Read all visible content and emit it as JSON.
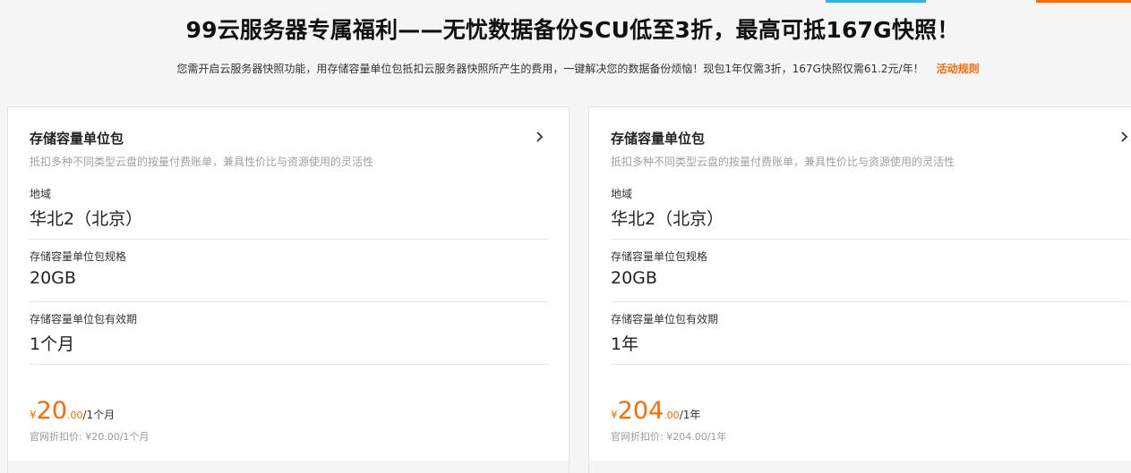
{
  "header": {
    "title": "99云服务器专属福利——无忧数据备份SCU低至3折，最高可抵167G快照！",
    "subtitle": "您需开启云服务器快照功能，用存储容量单位包抵扣云服务器快照所产生的费用，一键解决您的数据备份烦恼！现包1年仅需3折，167G快照仅需61.2元/年！",
    "rules_link": "活动规则"
  },
  "colors": {
    "accent": "#ff6a00",
    "top_blue": "#2fb0e8"
  },
  "cards": [
    {
      "title": "存储容量单位包",
      "arrow_icon": "chevron-right-icon",
      "description": "抵扣多种不同类型云盘的按量付费账单，兼具性价比与资源使用的灵活性",
      "region_label": "地域",
      "region_value": "华北2（北京）",
      "spec_label": "存储容量单位包规格",
      "spec_value": "20GB",
      "period_label": "存储容量单位包有效期",
      "period_value": "1个月",
      "currency": "¥",
      "price_int": "20",
      "price_dec": ".00",
      "price_unit": "/1个月",
      "list_price": "官网折扣价: ¥20.00/1个月"
    },
    {
      "title": "存储容量单位包",
      "arrow_icon": "chevron-right-icon",
      "description": "抵扣多种不同类型云盘的按量付费账单，兼具性价比与资源使用的灵活性",
      "region_label": "地域",
      "region_value": "华北2（北京）",
      "spec_label": "存储容量单位包规格",
      "spec_value": "20GB",
      "period_label": "存储容量单位包有效期",
      "period_value": "1年",
      "currency": "¥",
      "price_int": "204",
      "price_dec": ".00",
      "price_unit": "/1年",
      "list_price": "官网折扣价: ¥204.00/1年"
    }
  ]
}
